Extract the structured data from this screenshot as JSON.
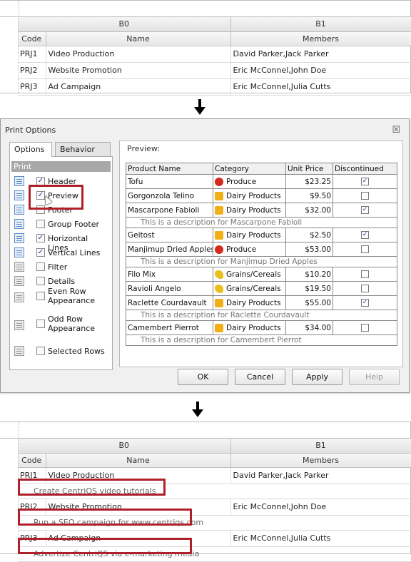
{
  "top_grid": {
    "bands": [
      "B0",
      "B1"
    ],
    "columns": [
      "Code",
      "Name",
      "Members"
    ],
    "rows": [
      {
        "code": "PRJ1",
        "name": "Video Production",
        "members": "David Parker,Jack Parker"
      },
      {
        "code": "PRJ2",
        "name": "Website Promotion",
        "members": "Eric McConnel,John Doe"
      },
      {
        "code": "PRJ3",
        "name": "Ad Campaign",
        "members": "Eric McConnel,Julia Cutts"
      }
    ]
  },
  "dialog": {
    "title": "Print Options",
    "close_glyph": "☒",
    "tabs": [
      "Options",
      "Behavior"
    ],
    "print_header": "Print",
    "options": [
      {
        "label": "Header",
        "checked": true
      },
      {
        "label": "Preview",
        "checked": true
      },
      {
        "label": "Footer",
        "checked": false
      },
      {
        "label": "Group Footer",
        "checked": false
      },
      {
        "label": "Horizontal Lines",
        "checked": true
      },
      {
        "label": "Vertical Lines",
        "checked": true
      },
      {
        "label": "Filter",
        "checked": false
      },
      {
        "label": "Details",
        "checked": false
      },
      {
        "label": "Even Row Appearance",
        "checked": false
      },
      {
        "label": "Odd Row Appearance",
        "checked": false
      },
      {
        "label": "Selected Rows",
        "checked": false
      }
    ],
    "preview_label": "Preview:",
    "preview_columns": [
      "Product Name",
      "Category",
      "Unit Price",
      "Discontinued"
    ],
    "preview_rows": [
      {
        "product": "Tofu",
        "category": "Produce",
        "icon": "produce",
        "price": "$23.25",
        "disc": true,
        "desc": ""
      },
      {
        "product": "Gorgonzola Telino",
        "category": "Dairy Products",
        "icon": "dairy",
        "price": "$9.50",
        "disc": false,
        "desc": ""
      },
      {
        "product": "Mascarpone Fabioli",
        "category": "Dairy Products",
        "icon": "dairy",
        "price": "$32.00",
        "disc": true,
        "desc": "This is a description for Mascarpone Fabioli"
      },
      {
        "product": "Geitost",
        "category": "Dairy Products",
        "icon": "dairy",
        "price": "$2.50",
        "disc": true,
        "desc": ""
      },
      {
        "product": "Manjimup Dried Apples",
        "category": "Produce",
        "icon": "produce",
        "price": "$53.00",
        "disc": false,
        "desc": "This is a description for Manjimup Dried Apples"
      },
      {
        "product": "Filo Mix",
        "category": "Grains/Cereals",
        "icon": "grains",
        "price": "$10.20",
        "disc": false,
        "desc": ""
      },
      {
        "product": "Ravioli Angelo",
        "category": "Grains/Cereals",
        "icon": "grains",
        "price": "$19.50",
        "disc": false,
        "desc": ""
      },
      {
        "product": "Raclette Courdavault",
        "category": "Dairy Products",
        "icon": "dairy",
        "price": "$55.00",
        "disc": true,
        "desc": "This is a description for Raclette Courdavault"
      },
      {
        "product": "Camembert Pierrot",
        "category": "Dairy Products",
        "icon": "dairy",
        "price": "$34.00",
        "disc": false,
        "desc": "This is a description for Camembert Pierrot"
      }
    ],
    "buttons": {
      "ok": "OK",
      "cancel": "Cancel",
      "apply": "Apply",
      "help": "Help"
    }
  },
  "bottom_grid": {
    "bands": [
      "B0",
      "B1"
    ],
    "columns": [
      "Code",
      "Name",
      "Members"
    ],
    "rows": [
      {
        "code": "PRJ1",
        "name": "Video Production",
        "members": "David Parker,Jack Parker",
        "preview": "Create CentriQS video tutorials"
      },
      {
        "code": "PRJ2",
        "name": "Website Promotion",
        "members": "Eric McConnel,John Doe",
        "preview": "Run a SEO campaign for www.centriqs.com"
      },
      {
        "code": "PRJ3",
        "name": "Ad Campaign",
        "members": "Eric McConnel,Julia Cutts",
        "preview": "Advertize CentriQS via e-marketing media"
      }
    ]
  },
  "colors": {
    "highlight_box": "#b0202a",
    "print_header_bg": "#a8a8a8"
  },
  "check_glyph": "✓"
}
